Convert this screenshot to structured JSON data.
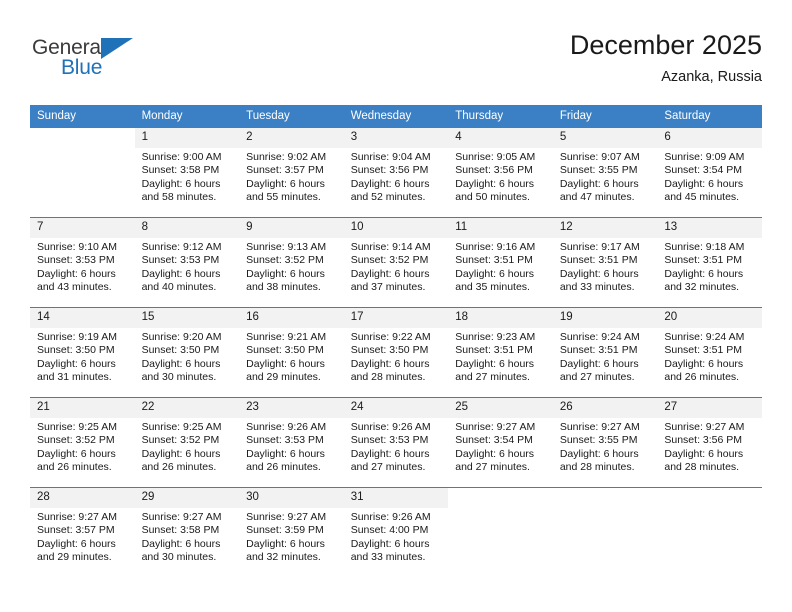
{
  "brand": {
    "name_part1": "General",
    "name_part2": "Blue",
    "accent_color": "#2072b8",
    "triangle_icon": "triangle-icon"
  },
  "header": {
    "title": "December 2025",
    "subtitle": "Azanka, Russia"
  },
  "calendar": {
    "header_color": "#3b7fc4",
    "weekday_headers": [
      "Sunday",
      "Monday",
      "Tuesday",
      "Wednesday",
      "Thursday",
      "Friday",
      "Saturday"
    ],
    "weeks": [
      [
        {
          "day": "",
          "sunrise": "",
          "sunset": "",
          "daylight_line1": "",
          "daylight_line2": "",
          "blank": true
        },
        {
          "day": "1",
          "sunrise": "Sunrise: 9:00 AM",
          "sunset": "Sunset: 3:58 PM",
          "daylight_line1": "Daylight: 6 hours",
          "daylight_line2": "and 58 minutes."
        },
        {
          "day": "2",
          "sunrise": "Sunrise: 9:02 AM",
          "sunset": "Sunset: 3:57 PM",
          "daylight_line1": "Daylight: 6 hours",
          "daylight_line2": "and 55 minutes."
        },
        {
          "day": "3",
          "sunrise": "Sunrise: 9:04 AM",
          "sunset": "Sunset: 3:56 PM",
          "daylight_line1": "Daylight: 6 hours",
          "daylight_line2": "and 52 minutes."
        },
        {
          "day": "4",
          "sunrise": "Sunrise: 9:05 AM",
          "sunset": "Sunset: 3:56 PM",
          "daylight_line1": "Daylight: 6 hours",
          "daylight_line2": "and 50 minutes."
        },
        {
          "day": "5",
          "sunrise": "Sunrise: 9:07 AM",
          "sunset": "Sunset: 3:55 PM",
          "daylight_line1": "Daylight: 6 hours",
          "daylight_line2": "and 47 minutes."
        },
        {
          "day": "6",
          "sunrise": "Sunrise: 9:09 AM",
          "sunset": "Sunset: 3:54 PM",
          "daylight_line1": "Daylight: 6 hours",
          "daylight_line2": "and 45 minutes."
        }
      ],
      [
        {
          "day": "7",
          "sunrise": "Sunrise: 9:10 AM",
          "sunset": "Sunset: 3:53 PM",
          "daylight_line1": "Daylight: 6 hours",
          "daylight_line2": "and 43 minutes."
        },
        {
          "day": "8",
          "sunrise": "Sunrise: 9:12 AM",
          "sunset": "Sunset: 3:53 PM",
          "daylight_line1": "Daylight: 6 hours",
          "daylight_line2": "and 40 minutes."
        },
        {
          "day": "9",
          "sunrise": "Sunrise: 9:13 AM",
          "sunset": "Sunset: 3:52 PM",
          "daylight_line1": "Daylight: 6 hours",
          "daylight_line2": "and 38 minutes."
        },
        {
          "day": "10",
          "sunrise": "Sunrise: 9:14 AM",
          "sunset": "Sunset: 3:52 PM",
          "daylight_line1": "Daylight: 6 hours",
          "daylight_line2": "and 37 minutes."
        },
        {
          "day": "11",
          "sunrise": "Sunrise: 9:16 AM",
          "sunset": "Sunset: 3:51 PM",
          "daylight_line1": "Daylight: 6 hours",
          "daylight_line2": "and 35 minutes."
        },
        {
          "day": "12",
          "sunrise": "Sunrise: 9:17 AM",
          "sunset": "Sunset: 3:51 PM",
          "daylight_line1": "Daylight: 6 hours",
          "daylight_line2": "and 33 minutes."
        },
        {
          "day": "13",
          "sunrise": "Sunrise: 9:18 AM",
          "sunset": "Sunset: 3:51 PM",
          "daylight_line1": "Daylight: 6 hours",
          "daylight_line2": "and 32 minutes."
        }
      ],
      [
        {
          "day": "14",
          "sunrise": "Sunrise: 9:19 AM",
          "sunset": "Sunset: 3:50 PM",
          "daylight_line1": "Daylight: 6 hours",
          "daylight_line2": "and 31 minutes."
        },
        {
          "day": "15",
          "sunrise": "Sunrise: 9:20 AM",
          "sunset": "Sunset: 3:50 PM",
          "daylight_line1": "Daylight: 6 hours",
          "daylight_line2": "and 30 minutes."
        },
        {
          "day": "16",
          "sunrise": "Sunrise: 9:21 AM",
          "sunset": "Sunset: 3:50 PM",
          "daylight_line1": "Daylight: 6 hours",
          "daylight_line2": "and 29 minutes."
        },
        {
          "day": "17",
          "sunrise": "Sunrise: 9:22 AM",
          "sunset": "Sunset: 3:50 PM",
          "daylight_line1": "Daylight: 6 hours",
          "daylight_line2": "and 28 minutes."
        },
        {
          "day": "18",
          "sunrise": "Sunrise: 9:23 AM",
          "sunset": "Sunset: 3:51 PM",
          "daylight_line1": "Daylight: 6 hours",
          "daylight_line2": "and 27 minutes."
        },
        {
          "day": "19",
          "sunrise": "Sunrise: 9:24 AM",
          "sunset": "Sunset: 3:51 PM",
          "daylight_line1": "Daylight: 6 hours",
          "daylight_line2": "and 27 minutes."
        },
        {
          "day": "20",
          "sunrise": "Sunrise: 9:24 AM",
          "sunset": "Sunset: 3:51 PM",
          "daylight_line1": "Daylight: 6 hours",
          "daylight_line2": "and 26 minutes."
        }
      ],
      [
        {
          "day": "21",
          "sunrise": "Sunrise: 9:25 AM",
          "sunset": "Sunset: 3:52 PM",
          "daylight_line1": "Daylight: 6 hours",
          "daylight_line2": "and 26 minutes."
        },
        {
          "day": "22",
          "sunrise": "Sunrise: 9:25 AM",
          "sunset": "Sunset: 3:52 PM",
          "daylight_line1": "Daylight: 6 hours",
          "daylight_line2": "and 26 minutes."
        },
        {
          "day": "23",
          "sunrise": "Sunrise: 9:26 AM",
          "sunset": "Sunset: 3:53 PM",
          "daylight_line1": "Daylight: 6 hours",
          "daylight_line2": "and 26 minutes."
        },
        {
          "day": "24",
          "sunrise": "Sunrise: 9:26 AM",
          "sunset": "Sunset: 3:53 PM",
          "daylight_line1": "Daylight: 6 hours",
          "daylight_line2": "and 27 minutes."
        },
        {
          "day": "25",
          "sunrise": "Sunrise: 9:27 AM",
          "sunset": "Sunset: 3:54 PM",
          "daylight_line1": "Daylight: 6 hours",
          "daylight_line2": "and 27 minutes."
        },
        {
          "day": "26",
          "sunrise": "Sunrise: 9:27 AM",
          "sunset": "Sunset: 3:55 PM",
          "daylight_line1": "Daylight: 6 hours",
          "daylight_line2": "and 28 minutes."
        },
        {
          "day": "27",
          "sunrise": "Sunrise: 9:27 AM",
          "sunset": "Sunset: 3:56 PM",
          "daylight_line1": "Daylight: 6 hours",
          "daylight_line2": "and 28 minutes."
        }
      ],
      [
        {
          "day": "28",
          "sunrise": "Sunrise: 9:27 AM",
          "sunset": "Sunset: 3:57 PM",
          "daylight_line1": "Daylight: 6 hours",
          "daylight_line2": "and 29 minutes."
        },
        {
          "day": "29",
          "sunrise": "Sunrise: 9:27 AM",
          "sunset": "Sunset: 3:58 PM",
          "daylight_line1": "Daylight: 6 hours",
          "daylight_line2": "and 30 minutes."
        },
        {
          "day": "30",
          "sunrise": "Sunrise: 9:27 AM",
          "sunset": "Sunset: 3:59 PM",
          "daylight_line1": "Daylight: 6 hours",
          "daylight_line2": "and 32 minutes."
        },
        {
          "day": "31",
          "sunrise": "Sunrise: 9:26 AM",
          "sunset": "Sunset: 4:00 PM",
          "daylight_line1": "Daylight: 6 hours",
          "daylight_line2": "and 33 minutes."
        },
        {
          "day": "",
          "sunrise": "",
          "sunset": "",
          "daylight_line1": "",
          "daylight_line2": "",
          "blank": true
        },
        {
          "day": "",
          "sunrise": "",
          "sunset": "",
          "daylight_line1": "",
          "daylight_line2": "",
          "blank": true
        },
        {
          "day": "",
          "sunrise": "",
          "sunset": "",
          "daylight_line1": "",
          "daylight_line2": "",
          "blank": true
        }
      ]
    ]
  }
}
